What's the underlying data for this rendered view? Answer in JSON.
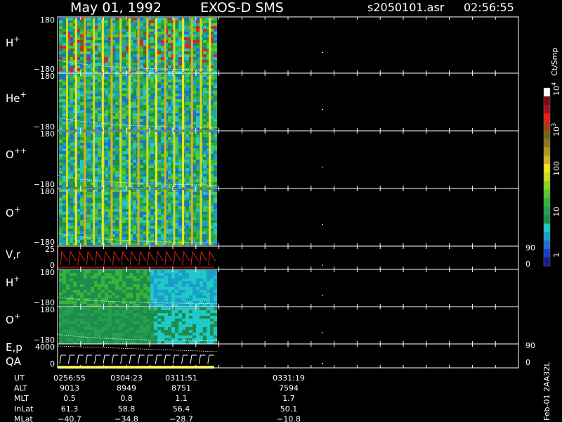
{
  "header": {
    "date": "May 01, 1992",
    "instrument": "EXOS-D SMS",
    "file": "s2050101.asr",
    "time": "02:56:55"
  },
  "colorbar": {
    "unit": "Ct/Smp",
    "ticks": [
      "1",
      "10",
      "100",
      "10",
      "10"
    ],
    "ticks_sup": [
      "",
      "",
      "",
      "3",
      "4"
    ],
    "colors": [
      "#1a1a8c",
      "#1c3cc8",
      "#1f6fd2",
      "#1aa0c8",
      "#20c8c8",
      "#1e8c4a",
      "#22a050",
      "#34b43a",
      "#5ac828",
      "#8cd21e",
      "#c8dc1e",
      "#f0e61e",
      "#d2b41e",
      "#b4961e",
      "#8c781e",
      "#78641e",
      "#aa3c14",
      "#e61e1e",
      "#a0141e",
      "#7a0a14",
      "#ffffff"
    ]
  },
  "panels": [
    {
      "label": "H",
      "sup": "+",
      "ytop": "180",
      "ybot": "−180"
    },
    {
      "label": "He",
      "sup": "+",
      "ytop": "180",
      "ybot": "−180"
    },
    {
      "label": "O",
      "sup": "++",
      "ytop": "180",
      "ybot": "−180"
    },
    {
      "label": "O",
      "sup": "+",
      "ytop": "180",
      "ybot": "−180"
    },
    {
      "label": "V,r",
      "sup": "",
      "ytop": "25",
      "ybot": "0",
      "rtop": "90",
      "rbot": "0"
    },
    {
      "label": "H",
      "sup": "+",
      "ytop": "180",
      "ybot": "−180"
    },
    {
      "label": "O",
      "sup": "+",
      "ytop": "180",
      "ybot": "−180"
    },
    {
      "label": "E,p",
      "label2": "QA",
      "sup": "",
      "ytop": "4000",
      "ybot": "0",
      "rtop": "90",
      "rbot": "0"
    }
  ],
  "ephemeris": {
    "rows": [
      {
        "name": "UT",
        "values": [
          "0256:55",
          "0304:23",
          "0311:51",
          "0331:19"
        ]
      },
      {
        "name": "ALT",
        "values": [
          "9013",
          "8949",
          "8751",
          "7594"
        ]
      },
      {
        "name": "MLT",
        "values": [
          "0.5",
          "0.8",
          "1.1",
          "1.7"
        ]
      },
      {
        "name": "InLat",
        "values": [
          "61.3",
          "58.8",
          "56.4",
          "50.1"
        ]
      },
      {
        "name": "MLat",
        "values": [
          "−40.7",
          "−34.8",
          "−28.7",
          "−10.8"
        ]
      }
    ]
  },
  "footer_id": "Feb-01 2AA32L"
}
